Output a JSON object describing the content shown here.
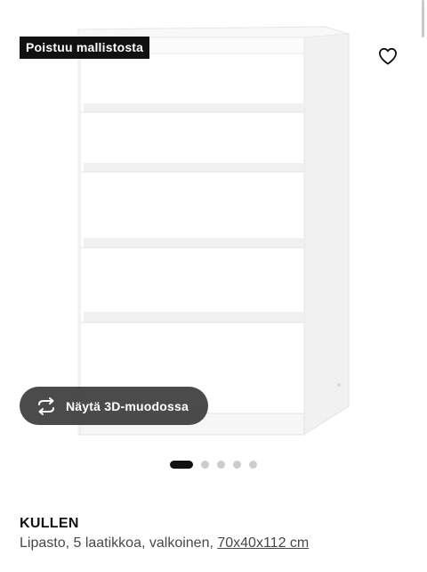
{
  "badge": {
    "label": "Poistuu mallistosta"
  },
  "favourite": {
    "icon": "heart-outline-icon"
  },
  "view_3d": {
    "label": "Näytä 3D-muodossa",
    "icon": "rotate-arrows-icon"
  },
  "carousel": {
    "total_images": 5,
    "active_index": 0
  },
  "product": {
    "name": "KULLEN",
    "description": "Lipasto, 5 laatikkoa, valkoinen, ",
    "dimensions": "70x40x112 cm"
  },
  "colors": {
    "badge_bg": "#111111",
    "button_bg": "#3c3c3c",
    "dot_active": "#111111",
    "dot_inactive": "#cccccc"
  }
}
